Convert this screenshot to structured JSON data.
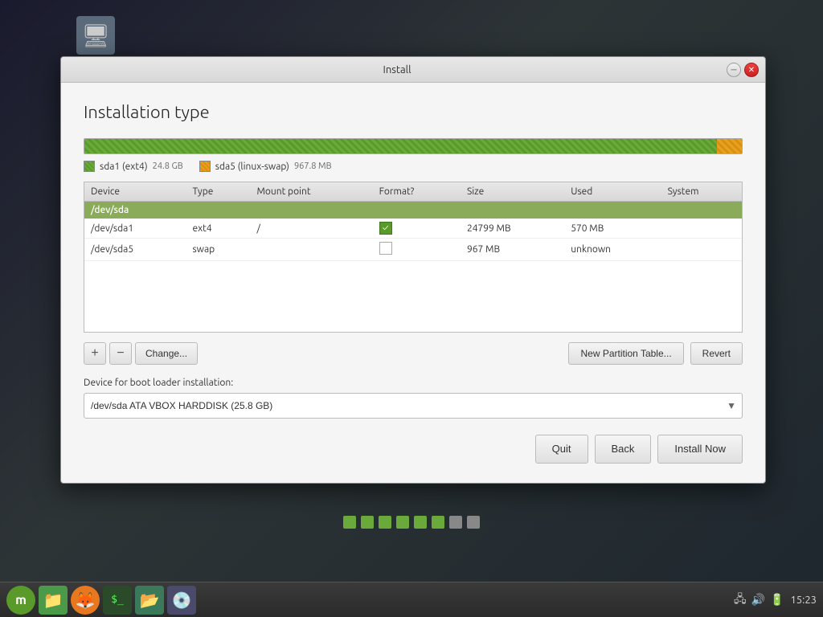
{
  "window": {
    "title": "Install",
    "page_title": "Installation type"
  },
  "partition_bar": {
    "partitions": [
      {
        "id": "ext4",
        "flex": 24.8
      },
      {
        "id": "swap",
        "flex": 0.9678
      }
    ]
  },
  "legend": {
    "items": [
      {
        "id": "ext4",
        "label": "sda1 (ext4)",
        "size": "24.8 GB"
      },
      {
        "id": "swap",
        "label": "sda5 (linux-swap)",
        "size": "967.8 MB"
      }
    ]
  },
  "table": {
    "headers": [
      "Device",
      "Type",
      "Mount point",
      "Format?",
      "Size",
      "Used",
      "System"
    ],
    "rows": [
      {
        "id": "sda-header",
        "device": "/dev/sda",
        "type": "",
        "mount": "",
        "format": "",
        "size": "",
        "used": "",
        "system": ""
      },
      {
        "id": "sda1",
        "device": "/dev/sda1",
        "type": "ext4",
        "mount": "/",
        "format": true,
        "size": "24799 MB",
        "used": "570 MB",
        "system": ""
      },
      {
        "id": "sda5",
        "device": "/dev/sda5",
        "type": "swap",
        "mount": "",
        "format": false,
        "size": "967 MB",
        "used": "unknown",
        "system": ""
      }
    ]
  },
  "toolbar": {
    "add_label": "+",
    "remove_label": "−",
    "change_label": "Change...",
    "new_partition_table_label": "New Partition Table...",
    "revert_label": "Revert"
  },
  "bootloader": {
    "label": "Device for boot loader installation:",
    "value": "/dev/sda   ATA VBOX HARDDISK (25.8 GB)",
    "options": [
      "/dev/sda   ATA VBOX HARDDISK (25.8 GB)"
    ]
  },
  "navigation": {
    "quit_label": "Quit",
    "back_label": "Back",
    "install_now_label": "Install Now"
  },
  "progress_dots": {
    "total": 8,
    "active_indices": [
      6,
      7
    ]
  },
  "taskbar": {
    "icons": [
      {
        "id": "mint",
        "label": "m"
      },
      {
        "id": "folder",
        "label": "📁"
      },
      {
        "id": "firefox",
        "label": "🦊"
      },
      {
        "id": "terminal",
        "label": "$"
      },
      {
        "id": "files",
        "label": "📂"
      },
      {
        "id": "disk",
        "label": "💿"
      }
    ],
    "sys_icons": [
      "🖧",
      "🔊",
      "🔋"
    ],
    "time": "15:23"
  }
}
